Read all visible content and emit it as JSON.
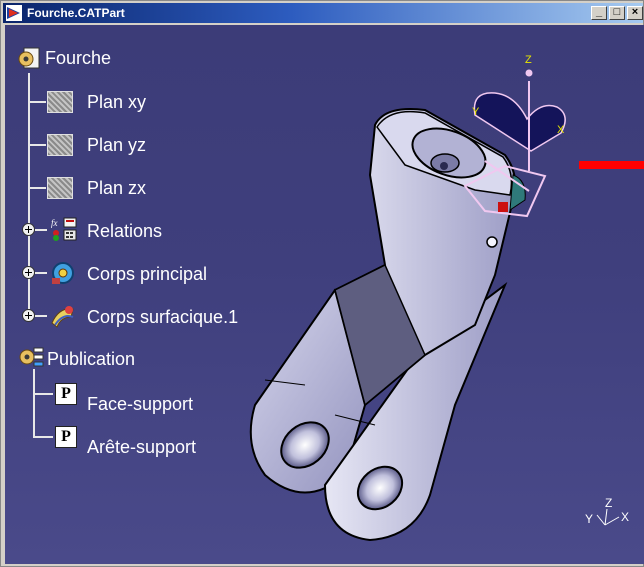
{
  "window": {
    "title": "Fourche.CATPart",
    "controls": {
      "minimize": "_",
      "maximize": "□",
      "close": "×"
    }
  },
  "tree": {
    "root": {
      "label": "Fourche",
      "icon": "part-gear-icon"
    },
    "planes": [
      {
        "label": "Plan xy",
        "icon": "plane-icon"
      },
      {
        "label": "Plan yz",
        "icon": "plane-icon"
      },
      {
        "label": "Plan zx",
        "icon": "plane-icon"
      }
    ],
    "expandables": [
      {
        "label": "Relations",
        "icon": "relations-icon"
      },
      {
        "label": "Corps principal",
        "icon": "body-gear-icon"
      },
      {
        "label": "Corps surfacique.1",
        "icon": "surface-body-icon"
      }
    ],
    "publication": {
      "label": "Publication",
      "icon": "publication-icon",
      "items": [
        {
          "label": "Face-support",
          "icon": "publish-p-icon"
        },
        {
          "label": "Arête-support",
          "icon": "publish-p-icon"
        }
      ]
    }
  },
  "compass": {
    "axes": {
      "x": "X",
      "y": "Y",
      "z": "Z"
    }
  },
  "axis_triad": {
    "x": "X",
    "y": "Y",
    "z": "Z"
  },
  "colors": {
    "background": "#3f3f7d",
    "part_fill": "#c9c9e3",
    "title_bar": "#0a246a",
    "tree_line": "#e8e8e8",
    "accent_red": "#ff0000"
  }
}
